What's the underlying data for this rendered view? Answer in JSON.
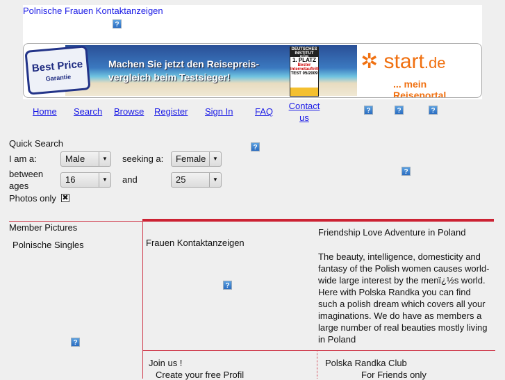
{
  "header": {
    "title": "Polnische Frauen Kontaktanzeigen"
  },
  "banner": {
    "best_price": "Best Price",
    "garantie": "Garantie",
    "slogan_line1": "Machen Sie jetzt den Reisepreis-",
    "slogan_line2": "vergleich beim Testsieger!",
    "badge_top": "DEUTSCHES INSTITUT FÜR SERVICE-QUALITÄT",
    "badge_main": "1. PLATZ",
    "badge_sub": "Bester Internetauftritt",
    "badge_test": "TEST 05/2009",
    "logo_main": "start",
    "logo_tld": ".de",
    "tagline": "... mein Reiseportal"
  },
  "nav": {
    "items": [
      "Home",
      "Search",
      "Browse",
      "Register",
      "Sign In",
      "FAQ",
      "Contact us"
    ]
  },
  "icons": {
    "broken_image": "question-mark-icon"
  },
  "quick_search": {
    "title": "Quick Search",
    "i_am_label": "I am a:",
    "i_am_value": "Male",
    "seeking_label": "seeking a:",
    "seeking_value": "Female",
    "between_label": "between ages",
    "age_from": "16",
    "and_label": "and",
    "age_to": "25",
    "photos_label": "Photos only",
    "photos_checked": true
  },
  "left": {
    "title": "Member Pictures",
    "subtitle": "Polnische Singles"
  },
  "center": {
    "title": "Frauen Kontaktanzeigen"
  },
  "right": {
    "title": "Friendship Love Adventure in Poland",
    "body": "The beauty, intelligence, domesticity and fantasy of the Polish women causes world-wide large interest by the menï¿½s world. Here with Polska Randka you can find such a polish dream which covers all your imaginations. We do have as members a large number of real beauties mostly living in Poland"
  },
  "join": {
    "title": "Join us !",
    "subtitle": "Create your free Profil"
  },
  "club": {
    "title": "Polska Randka Club",
    "subtitle": "For Friends only"
  },
  "colors": {
    "accent": "#cc2233",
    "link": "#1a1ae6",
    "background": "#efefef"
  }
}
